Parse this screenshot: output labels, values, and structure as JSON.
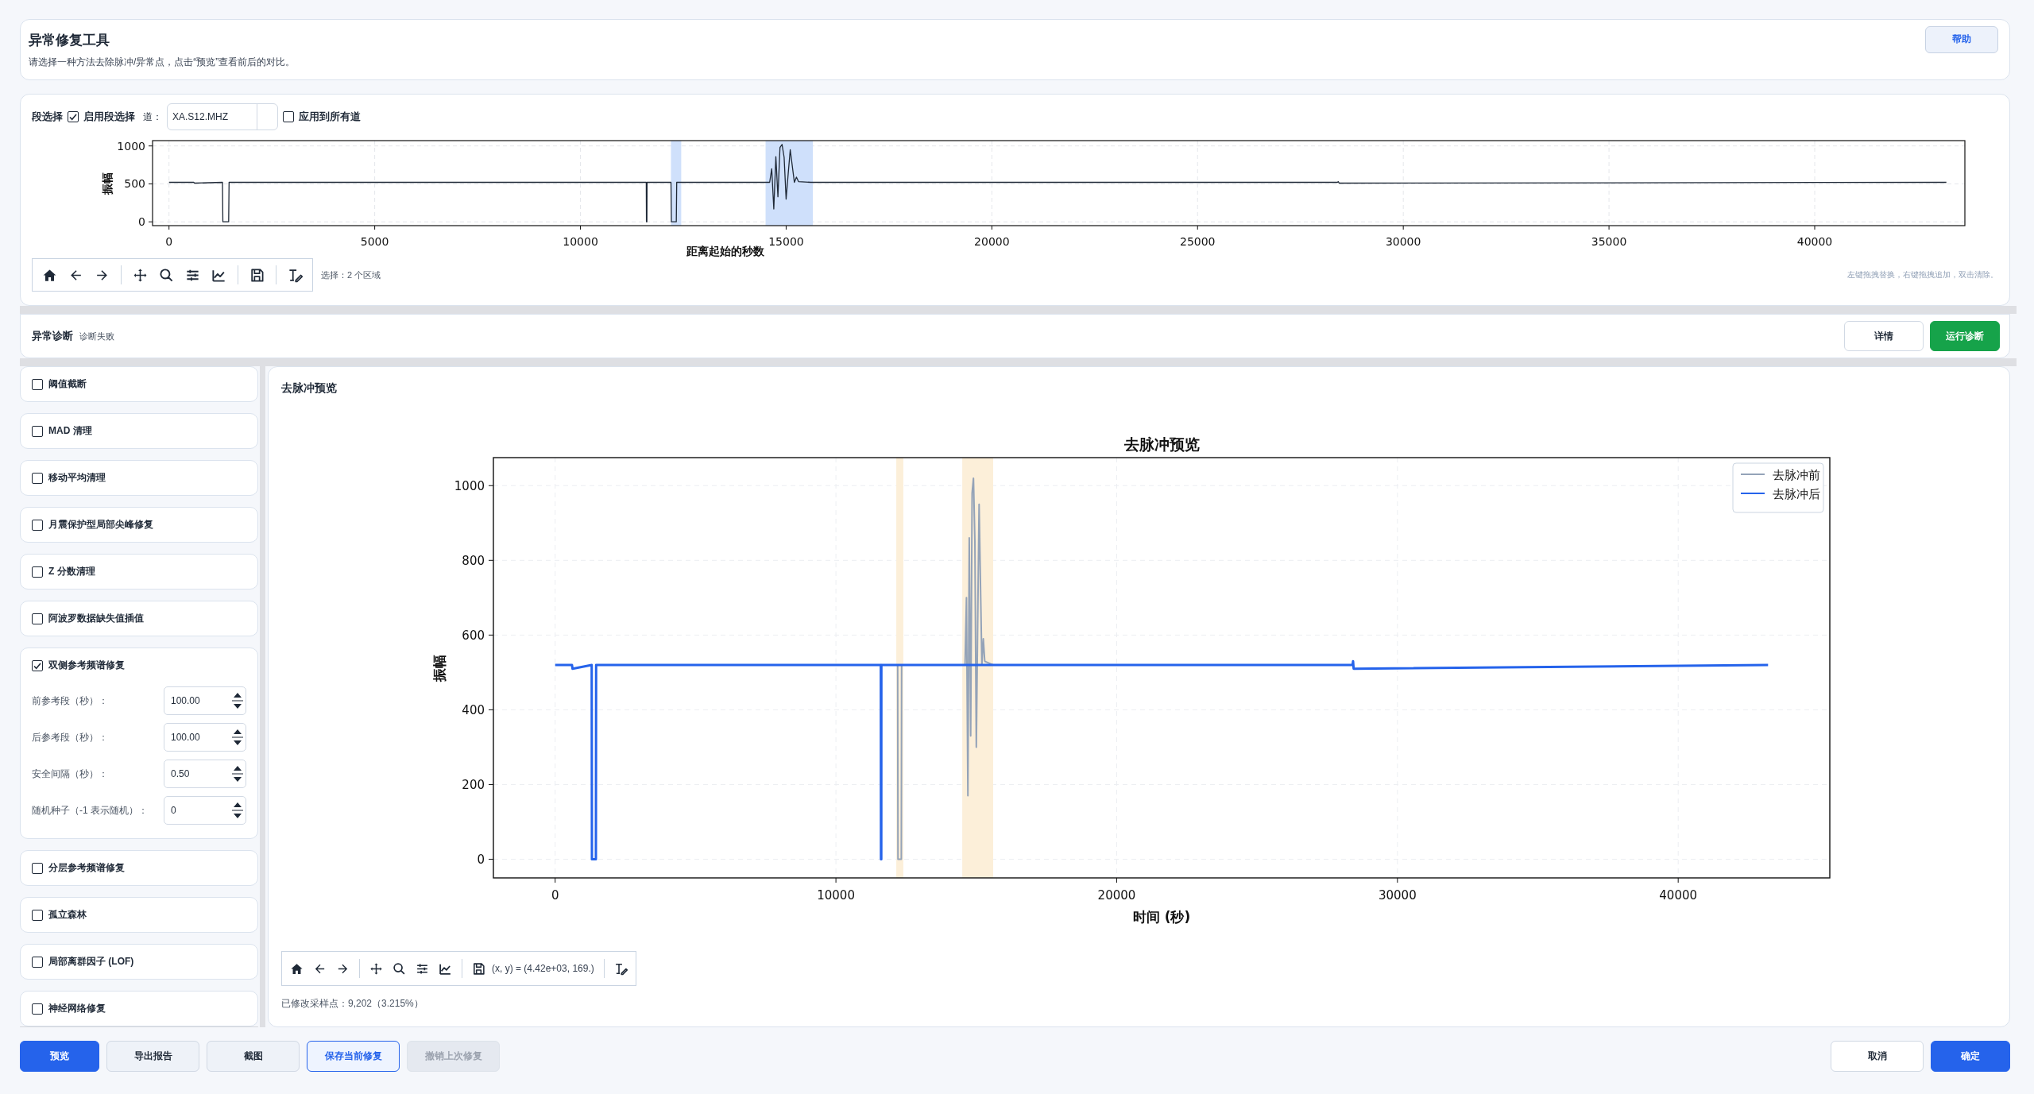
{
  "header": {
    "title": "异常修复工具",
    "subtitle": "请选择一种方法去除脉冲/异常点，点击“预览”查看前后的对比。",
    "help_button": "帮助"
  },
  "segment": {
    "label": "段选择",
    "enable": {
      "label": "启用段选择",
      "checked": true
    },
    "channel_label": "道：",
    "channel_value": "XA.S12.MHZ",
    "apply_all": {
      "label": "应用到所有道",
      "checked": false
    },
    "chart_data": {
      "type": "line",
      "xlabel": "距离起始的秒数",
      "ylabel": "振幅",
      "xlim": [
        -400,
        43650
      ],
      "ylim": [
        -50,
        1070
      ],
      "xticks": [
        {
          "value": 0,
          "label": "0"
        },
        5000,
        10000,
        15000,
        20000,
        25000,
        30000,
        35000,
        40000
      ],
      "yticks": [
        {
          "value": 0,
          "label": "0"
        },
        500,
        1000
      ],
      "x": [
        0,
        600,
        620,
        1300,
        1310,
        1450,
        1460,
        2500,
        11600,
        11605,
        11615,
        11620,
        12200,
        12210,
        12330,
        12340,
        13000,
        14600,
        14650,
        14700,
        14750,
        14800,
        14850,
        14900,
        14950,
        15000,
        15050,
        15100,
        15200,
        15250,
        15300,
        15600,
        28400,
        28420,
        28440,
        43200
      ],
      "series": [
        {
          "color": "#1f2937",
          "values": [
            520,
            520,
            510,
            520,
            0,
            0,
            520,
            520,
            520,
            0,
            0,
            520,
            520,
            0,
            0,
            520,
            520,
            520,
            700,
            170,
            860,
            330,
            980,
            1020,
            850,
            300,
            630,
            950,
            520,
            590,
            530,
            520,
            520,
            530,
            510,
            520
          ]
        }
      ],
      "grid": true,
      "bands": [
        {
          "axis": "x",
          "from": 12200,
          "to": 12450,
          "color": "#cfe0fb"
        },
        {
          "axis": "x",
          "from": 14500,
          "to": 15650,
          "color": "#cfe0fb"
        }
      ]
    },
    "status": "选择：2 个区域",
    "hint": "左键拖拽替换，右键拖拽追加，双击清除。"
  },
  "diagnosis": {
    "title": "异常诊断",
    "status": "诊断失败",
    "buttons": [
      {
        "label": "详情",
        "kind": "secondary"
      },
      {
        "label": "运行诊断",
        "kind": "success"
      }
    ]
  },
  "methods": [
    {
      "label": "阈值截断",
      "checked": false
    },
    {
      "label": "MAD 清理",
      "checked": false
    },
    {
      "label": "移动平均清理",
      "checked": false
    },
    {
      "label": "月震保护型局部尖峰修复",
      "checked": false
    },
    {
      "label": "Z 分数清理",
      "checked": false
    },
    {
      "label": "阿波罗数据缺失值插值",
      "checked": false
    },
    {
      "label": "双侧参考频谱修复",
      "checked": true,
      "params": [
        {
          "label": "前参考段（秒）：",
          "value": "100.00"
        },
        {
          "label": "后参考段（秒）：",
          "value": "100.00"
        },
        {
          "label": "安全间隔（秒）：",
          "value": "0.50"
        },
        {
          "label": "随机种子（-1 表示随机）：",
          "value": "0"
        }
      ]
    },
    {
      "label": "分层参考频谱修复",
      "checked": false
    },
    {
      "label": "孤立森林",
      "checked": false
    },
    {
      "label": "局部离群因子 (LOF)",
      "checked": false
    },
    {
      "label": "神经网络修复",
      "checked": false
    }
  ],
  "preview": {
    "title": "去脉冲预览",
    "chart_data": {
      "type": "line",
      "title": "去脉冲预览",
      "xlabel": "时间 (秒)",
      "ylabel": "振幅",
      "xlim": [
        -2200,
        45400
      ],
      "ylim": [
        -50,
        1075
      ],
      "xticks": [
        {
          "value": 0,
          "label": "0"
        },
        10000,
        20000,
        30000,
        40000
      ],
      "yticks": [
        {
          "value": 0,
          "label": "0"
        },
        200,
        400,
        600,
        800,
        1000
      ],
      "x": [
        0,
        600,
        620,
        1300,
        1310,
        1450,
        1460,
        2500,
        11600,
        11605,
        11615,
        11620,
        12200,
        12210,
        12330,
        12340,
        13000,
        14600,
        14650,
        14700,
        14750,
        14800,
        14850,
        14900,
        14950,
        15000,
        15050,
        15100,
        15200,
        15250,
        15300,
        15600,
        28400,
        28420,
        28440,
        43200
      ],
      "series": [
        {
          "name": "去脉冲前",
          "color": "#94a3b8",
          "values": [
            null,
            null,
            null,
            null,
            null,
            null,
            null,
            null,
            null,
            null,
            null,
            null,
            520,
            0,
            0,
            520,
            null,
            520,
            700,
            170,
            860,
            330,
            980,
            1020,
            850,
            300,
            630,
            950,
            520,
            590,
            530,
            520,
            null,
            null,
            null,
            null
          ]
        },
        {
          "name": "去脉冲后",
          "color": "#2563eb",
          "values": [
            520,
            520,
            510,
            520,
            0,
            0,
            520,
            520,
            520,
            0,
            0,
            520,
            520,
            520,
            520,
            520,
            520,
            520,
            520,
            520,
            520,
            520,
            520,
            520,
            520,
            520,
            520,
            520,
            520,
            520,
            520,
            520,
            520,
            530,
            510,
            520
          ]
        }
      ],
      "grid": true,
      "legend": true,
      "bands": [
        {
          "axis": "x",
          "from": 12150,
          "to": 12400,
          "color": "#fcefd9"
        },
        {
          "axis": "x",
          "from": 14500,
          "to": 15600,
          "color": "#fcefd9"
        }
      ]
    },
    "coordinates": "(x, y) = (4.42e+03, 169.)",
    "modified": "已修改采样点：9,202（3.215%）"
  },
  "footer": {
    "left_buttons": [
      {
        "label": "预览",
        "kind": "primary",
        "disabled": false
      },
      {
        "label": "导出报告",
        "kind": "light",
        "disabled": false
      },
      {
        "label": "截图",
        "kind": "light",
        "disabled": false
      },
      {
        "label": "保存当前修复",
        "kind": "outline",
        "disabled": false
      },
      {
        "label": "撤销上次修复",
        "kind": "light",
        "disabled": true
      }
    ],
    "right_buttons": [
      {
        "label": "取消",
        "kind": "secondary",
        "disabled": false
      },
      {
        "label": "确定",
        "kind": "primary",
        "disabled": false
      }
    ]
  }
}
